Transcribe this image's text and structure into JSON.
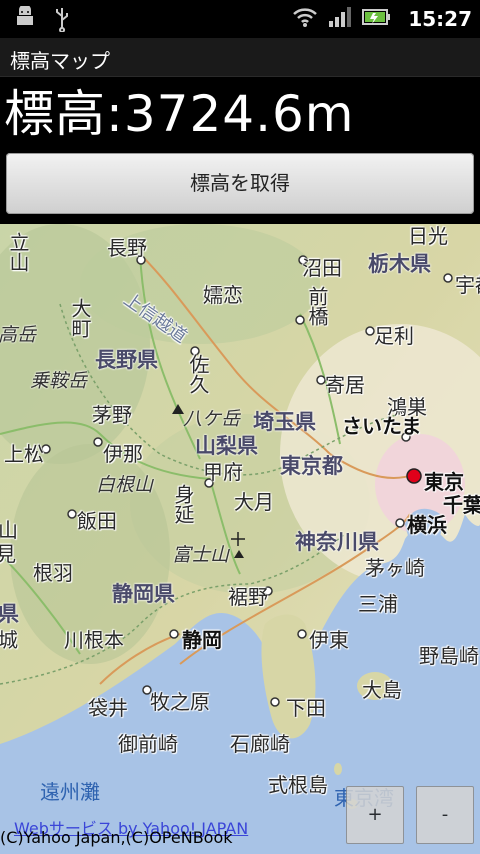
{
  "status_bar": {
    "time": "15:27"
  },
  "app": {
    "title": "標高マップ"
  },
  "elevation": {
    "text": "標高:3724.6m"
  },
  "get_button": {
    "label": "標高を取得"
  },
  "map": {
    "cities": [
      "長野",
      "沼田",
      "日光",
      "宇都",
      "大町",
      "嬬恋",
      "前橋",
      "足利",
      "佐久",
      "寄居",
      "鴻巣",
      "茅野",
      "さいたま",
      "上松",
      "伊那",
      "甲府",
      "東京",
      "千葉",
      "飯田",
      "身延",
      "大月",
      "横浜",
      "富士山",
      "茅ヶ崎",
      "根羽",
      "三浦",
      "静岡",
      "裾野",
      "伊東",
      "野島崎",
      "川根本",
      "大島",
      "袋井",
      "牧之原",
      "下田",
      "御前崎",
      "石廊崎",
      "式根島",
      "立山",
      "高岳",
      "城",
      "見",
      "山"
    ],
    "prefectures": [
      "長野県",
      "栃木県",
      "山梨県",
      "埼玉県",
      "東京都",
      "神奈川県",
      "静岡県",
      "県"
    ],
    "mountains": [
      "乗鞍岳",
      "八ケ岳",
      "白根山",
      "上信越道"
    ],
    "seas": [
      "遠州灘",
      "東京湾"
    ]
  },
  "zoom": {
    "in": "+",
    "out": "-"
  },
  "credits": {
    "service": "Webサービス by Yahoo! JAPAN",
    "copyright": "(C)Yahoo Japan,(C)OPeNBook"
  }
}
